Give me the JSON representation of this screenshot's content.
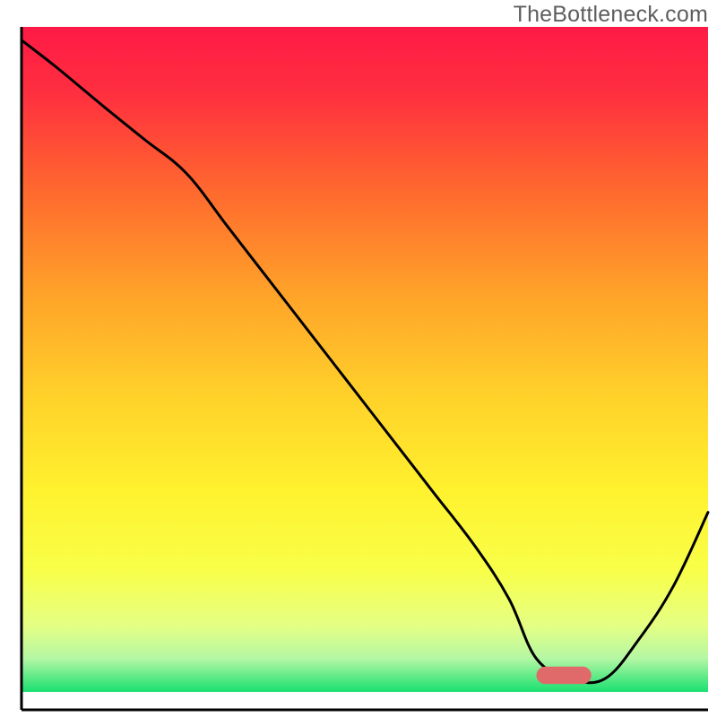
{
  "watermark": "TheBottleneck.com",
  "chart_data": {
    "type": "line",
    "title": "",
    "xlabel": "",
    "ylabel": "",
    "xlim": [
      0,
      100
    ],
    "ylim": [
      0,
      100
    ],
    "grid": false,
    "legend": false,
    "background": {
      "type": "vertical-gradient",
      "stops": [
        {
          "offset": 0.0,
          "color": "#ff1a46"
        },
        {
          "offset": 0.1,
          "color": "#ff2f3f"
        },
        {
          "offset": 0.25,
          "color": "#ff6a2e"
        },
        {
          "offset": 0.4,
          "color": "#ffa229"
        },
        {
          "offset": 0.55,
          "color": "#ffd02a"
        },
        {
          "offset": 0.7,
          "color": "#fff22e"
        },
        {
          "offset": 0.82,
          "color": "#f8ff4a"
        },
        {
          "offset": 0.9,
          "color": "#e5ff84"
        },
        {
          "offset": 0.95,
          "color": "#b4f7a4"
        },
        {
          "offset": 1.0,
          "color": "#19e070"
        }
      ]
    },
    "bottom_band_color": "#ffffff",
    "series": [
      {
        "name": "bottleneck-curve",
        "color": "#000000",
        "stroke_width": 3,
        "x": [
          0,
          5,
          12,
          18,
          24,
          30,
          36,
          42,
          48,
          54,
          60,
          66,
          71,
          75,
          80,
          85,
          90,
          95,
          100
        ],
        "y": [
          98,
          94,
          88,
          83,
          78,
          70,
          62,
          54,
          46,
          38,
          30,
          22,
          14,
          5,
          2,
          2,
          8,
          16,
          27
        ]
      }
    ],
    "marker": {
      "name": "optimal-range",
      "shape": "capsule",
      "color": "#e06a6a",
      "x_start": 75,
      "x_end": 83,
      "y": 2.5,
      "height": 2.6
    }
  }
}
